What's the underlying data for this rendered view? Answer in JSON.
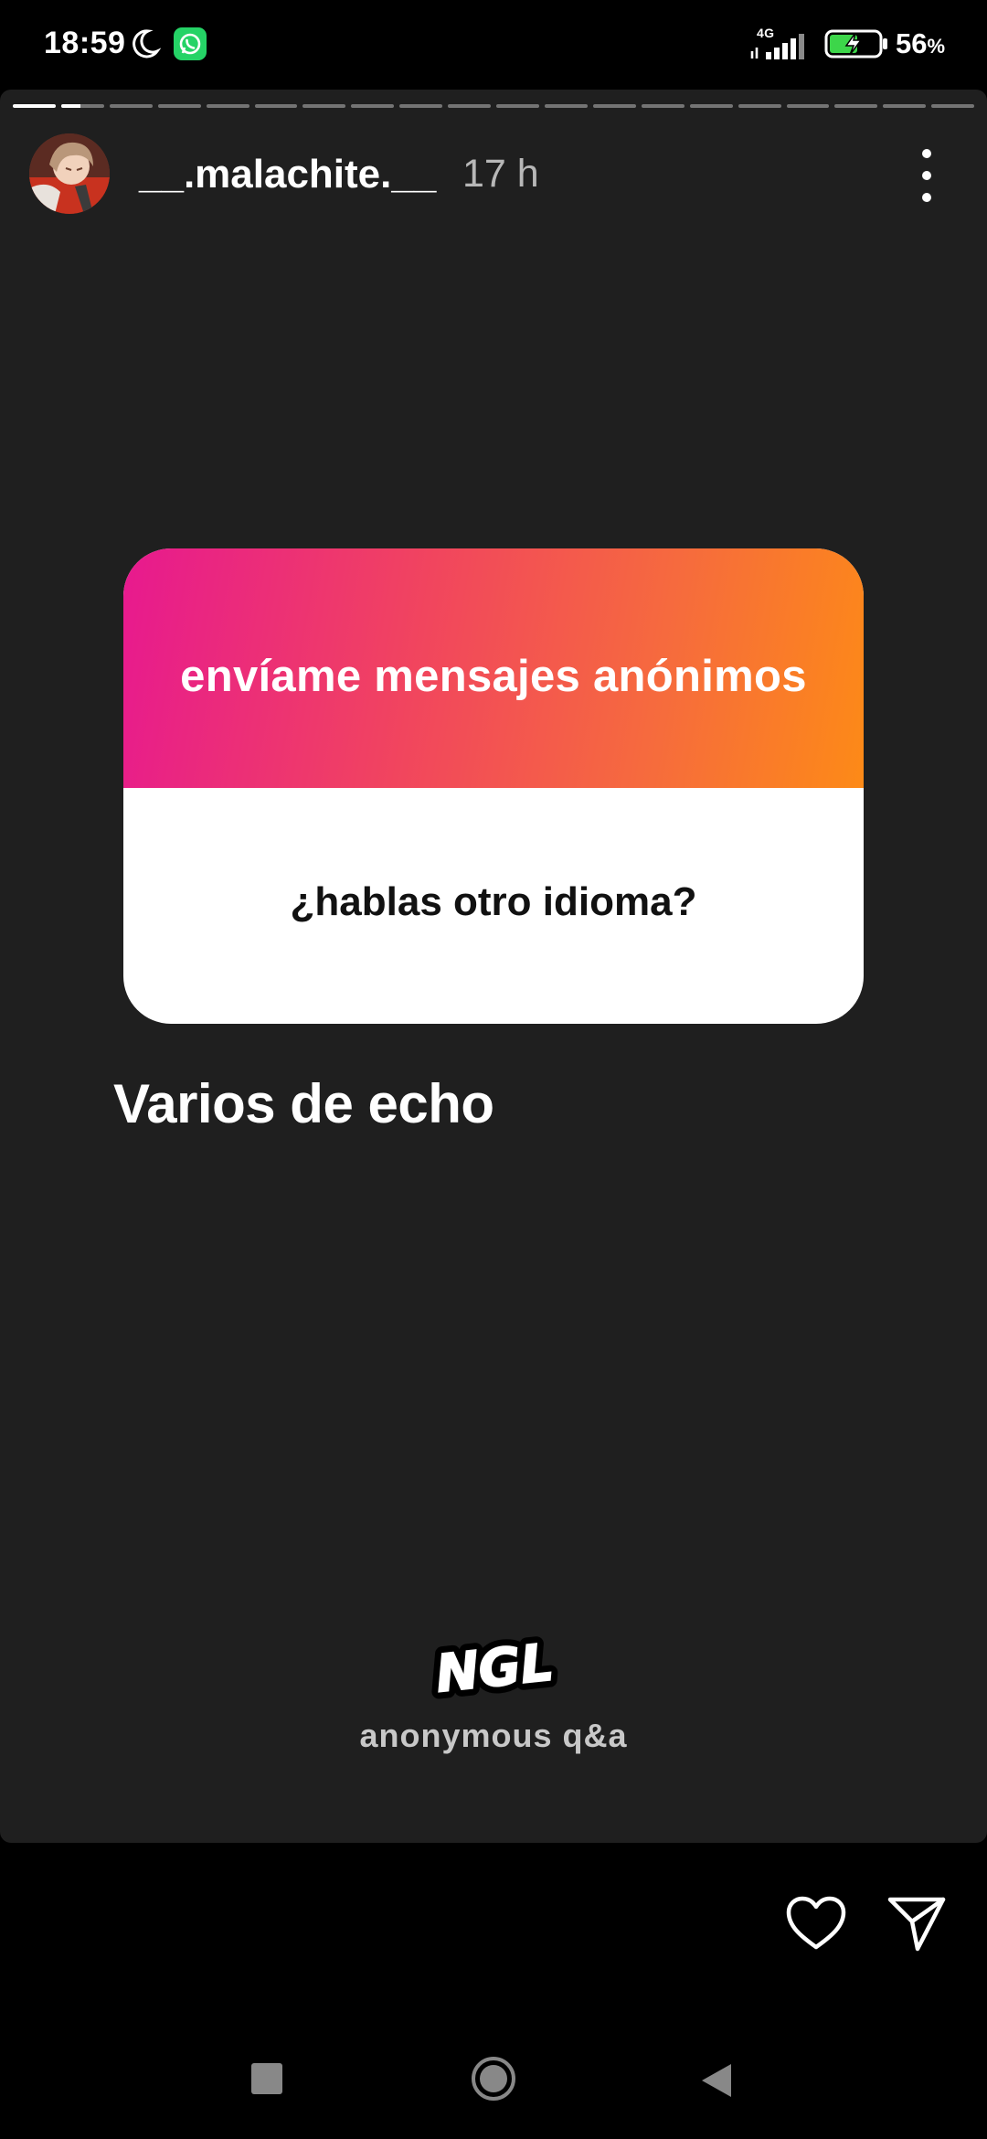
{
  "status_bar": {
    "time": "18:59",
    "network": "4G",
    "battery_level": "56",
    "battery_unit": "%",
    "icons": [
      "moon-icon",
      "whatsapp-icon",
      "signal-icon",
      "battery-charging-icon"
    ]
  },
  "story": {
    "segment_count": 20,
    "current_segment": 2,
    "current_segment_progress": 0.45,
    "author": {
      "username": "__.malachite.__",
      "posted_ago": "17 h"
    },
    "question_card": {
      "title": "envíame mensajes anónimos",
      "question": "¿hablas otro idioma?",
      "gradient_colors": [
        "#e7198f",
        "#f1455e",
        "#fd8a17"
      ]
    },
    "reply": "Varios de echo",
    "branding": {
      "logo_text": "NGL",
      "subtitle": "anonymous q&a"
    }
  },
  "actions": {
    "icons": [
      "heart-icon",
      "send-icon"
    ]
  },
  "nav_bar": {
    "icons": [
      "recents-icon",
      "home-icon",
      "back-icon"
    ]
  },
  "colors": {
    "background": "#000000",
    "story_background": "#1f1f1f",
    "whatsapp_green": "#25d366"
  }
}
